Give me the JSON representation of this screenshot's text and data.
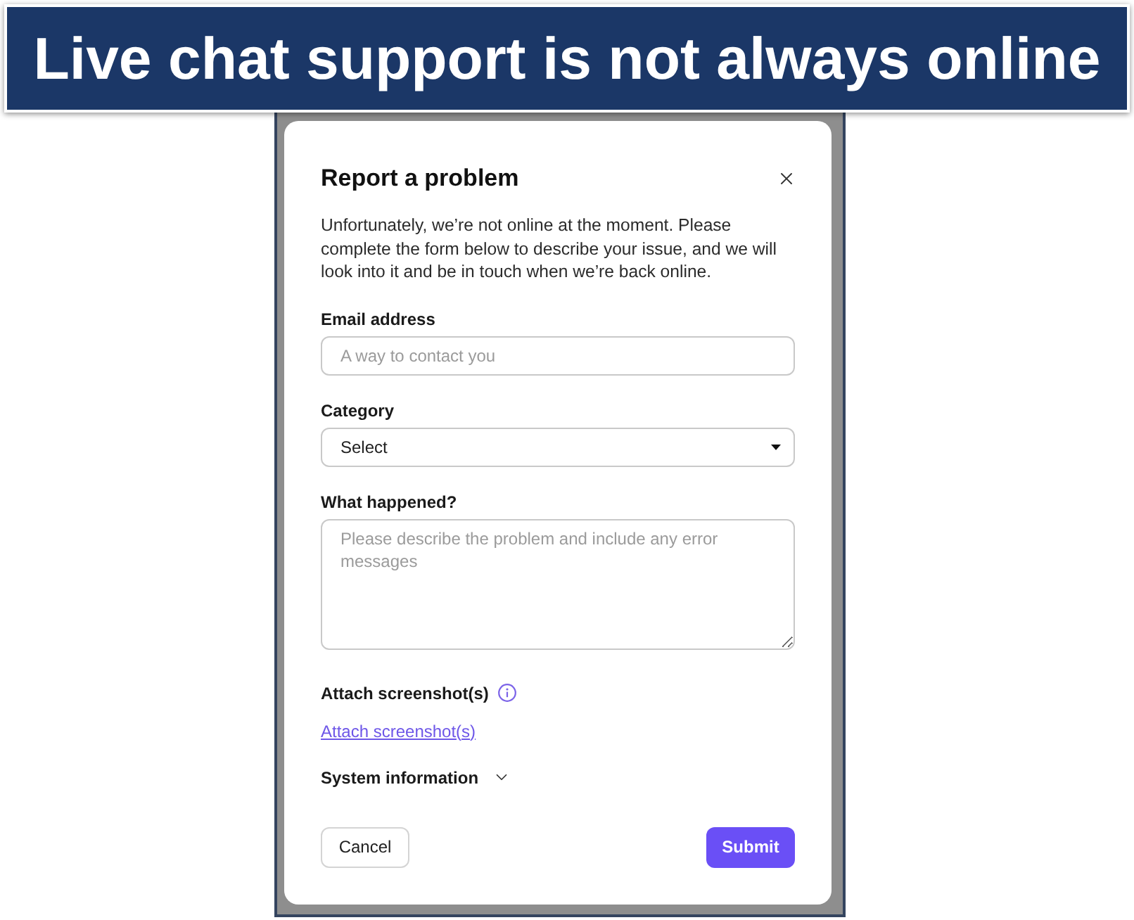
{
  "banner": {
    "title": "Live chat support is not always online"
  },
  "dialog": {
    "title": "Report a problem",
    "intro": "Unfortunately, we’re not online at the moment. Please complete the form below to describe your issue, and we will look into it and be in touch when we’re back online.",
    "fields": [
      {
        "kind": "input",
        "label": "Email address",
        "placeholder": "A way to contact you"
      },
      {
        "kind": "select",
        "label": "Category",
        "value": "Select"
      },
      {
        "kind": "textarea",
        "label": "What happened?",
        "placeholder": "Please describe the problem and include any error messages"
      }
    ],
    "attachments": {
      "label": "Attach screenshot(s)",
      "link": "Attach screenshot(s)"
    },
    "system_information": {
      "label": "System information",
      "expanded": false
    },
    "buttons": [
      {
        "kind": "secondary",
        "label": "Cancel"
      },
      {
        "kind": "primary",
        "label": "Submit"
      }
    ]
  }
}
